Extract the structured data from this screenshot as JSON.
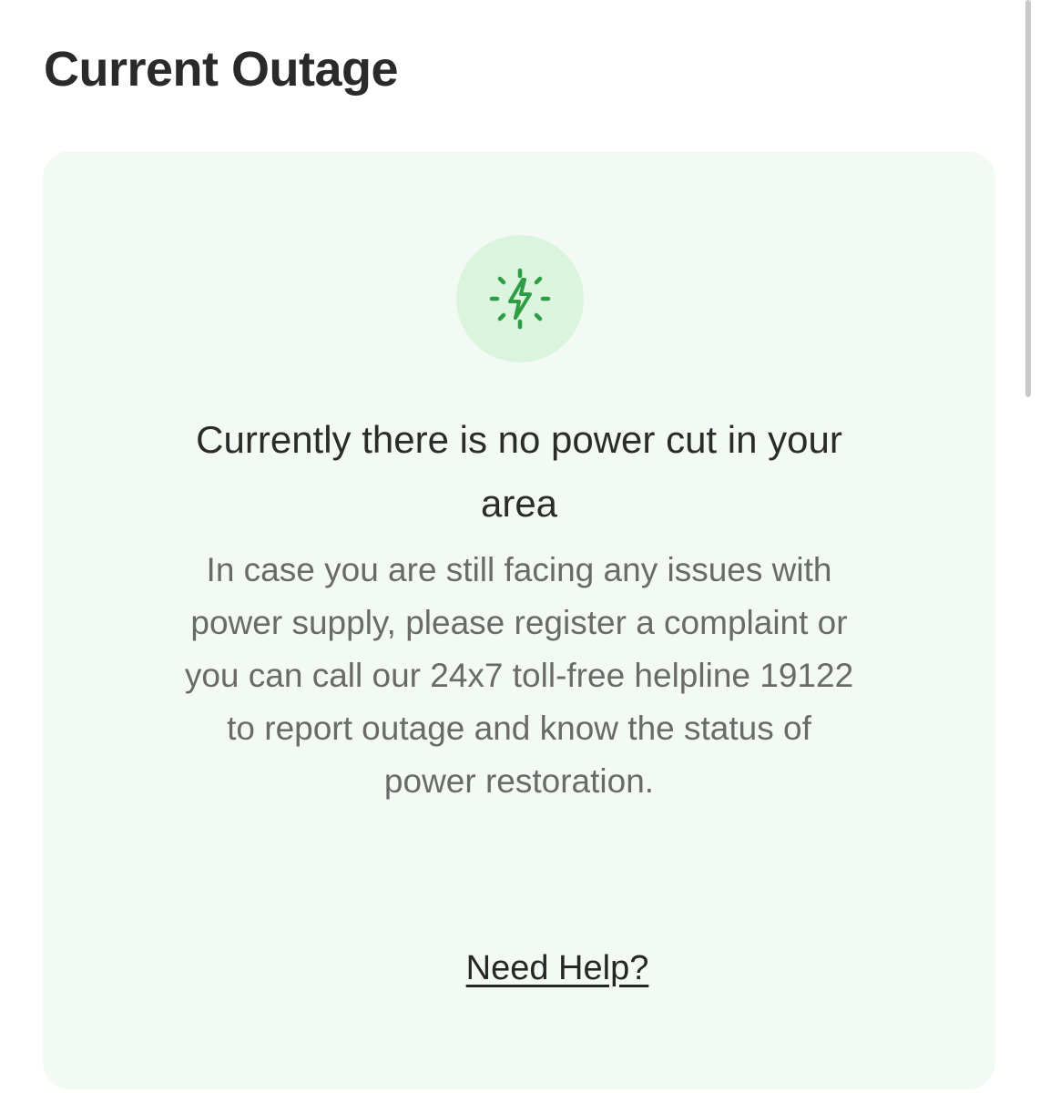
{
  "header": {
    "title": "Current Outage"
  },
  "status_card": {
    "icon": "power-bolt-icon",
    "headline_lines": [
      "Currently there is no power cut in your",
      "area"
    ],
    "message_lines": [
      "In case you are still facing any issues with",
      "power supply, please register a complaint or",
      "you can call our 24x7 toll-free helpline 19122",
      "to report outage and know the status of",
      "power restoration."
    ],
    "help_link_label": "Need Help?"
  },
  "colors": {
    "card_background": "#f3faf3",
    "icon_background": "#dbf4de",
    "icon_accent": "#2e9d46",
    "title_text": "#2a2a2a",
    "body_text": "#6a6a6a"
  }
}
